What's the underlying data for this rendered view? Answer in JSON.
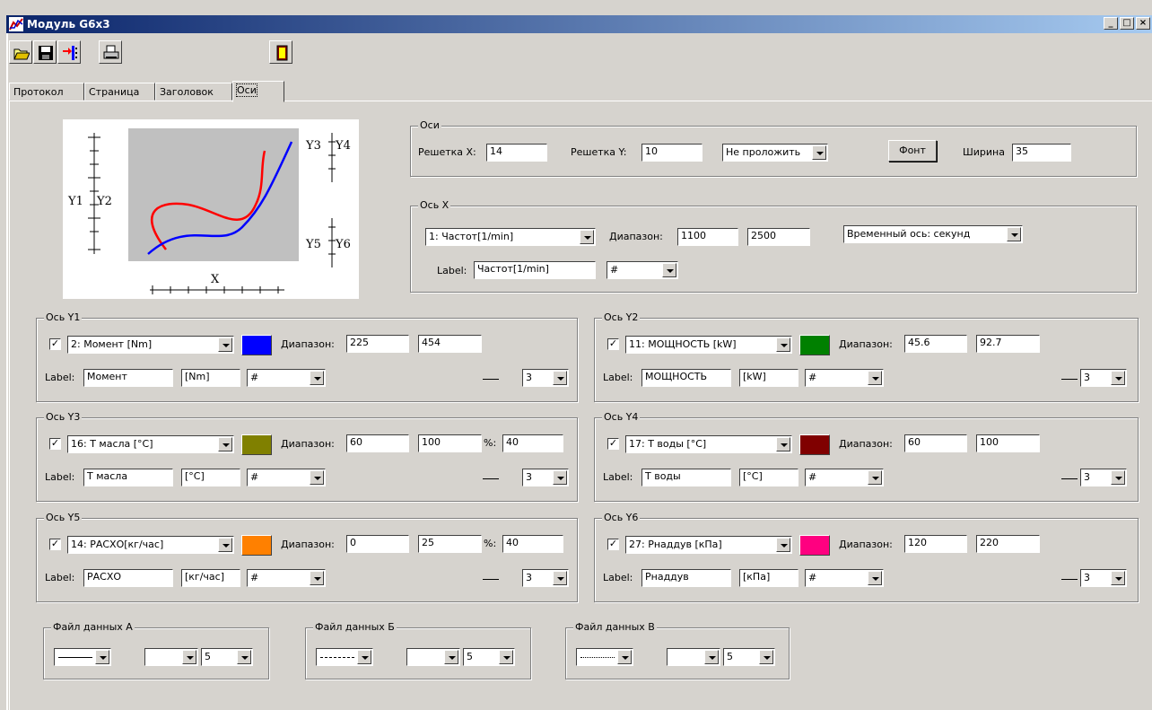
{
  "window": {
    "title": "Модуль G6x3",
    "controls": [
      "_",
      "□",
      "×"
    ]
  },
  "toolbar": {
    "icons": [
      "open-folder-icon",
      "save-icon",
      "import-icon",
      "print-icon",
      "exit-icon"
    ]
  },
  "tabs": [
    {
      "label": "Протокол"
    },
    {
      "label": "Страница"
    },
    {
      "label": "Заголовок"
    },
    {
      "label": "Оси",
      "active": true
    }
  ],
  "preview": {
    "y1": "Y1",
    "y2": "Y2",
    "y3": "Y3",
    "y4": "Y4",
    "y5": "Y5",
    "y6": "Y6",
    "x": "X",
    "colors": {
      "red": "#ff0000",
      "blue": "#0000ff",
      "plot_bg": "#c0c0c0"
    }
  },
  "axes": {
    "legend": "Оси",
    "grid_x_label": "Решетка X:",
    "grid_x": "14",
    "grid_y_label": "Решетка Y:",
    "grid_y": "10",
    "mode": "Не проложить",
    "font_button": "Фонт",
    "width_label": "Ширина",
    "width": "35"
  },
  "axis_x": {
    "legend": "Ось X",
    "channel": "1: Частот[1/min]",
    "range_label": "Диапазон:",
    "min": "1100",
    "max": "2500",
    "time_axis": "Временный ось: секунд",
    "label_caption": "Label:",
    "label": "Частот[1/min]",
    "fmt": "#"
  },
  "y_axes": [
    {
      "legend": "Ось Y1",
      "checked": true,
      "channel": "2: Момент  [Nm]",
      "color": "#0000ff",
      "range_label": "Диапазон:",
      "min": "225",
      "max": "454",
      "label_caption": "Label:",
      "label": "Момент",
      "unit": "[Nm]",
      "fmt": "#",
      "width": "3"
    },
    {
      "legend": "Ось Y2",
      "checked": true,
      "channel": "11: МОЩНОСТЬ [kW]",
      "color": "#008000",
      "range_label": "Диапазон:",
      "min": "45.6",
      "max": "92.7",
      "label_caption": "Label:",
      "label": "МОЩНОСТЬ",
      "unit": "[kW]",
      "fmt": "#",
      "width": "3"
    },
    {
      "legend": "Ось Y3",
      "checked": true,
      "channel": "16: Т масла  [°C]",
      "color": "#808000",
      "range_label": "Диапазон:",
      "min": "60",
      "max": "100",
      "pct_label": "%:",
      "pct": "40",
      "label_caption": "Label:",
      "label": "Т масла",
      "unit": "[°C]",
      "fmt": "#",
      "width": "3"
    },
    {
      "legend": "Ось Y4",
      "checked": true,
      "channel": "17: Т воды  [°C]",
      "color": "#800000",
      "range_label": "Диапазон:",
      "min": "60",
      "max": "100",
      "label_caption": "Label:",
      "label": "Т воды",
      "unit": "[°C]",
      "fmt": "#",
      "width": "3"
    },
    {
      "legend": "Ось Y5",
      "checked": true,
      "channel": "14: РАСХО[кг/час]",
      "color": "#ff8000",
      "range_label": "Диапазон:",
      "min": "0",
      "max": "25",
      "pct_label": "%:",
      "pct": "40",
      "label_caption": "Label:",
      "label": "РАСХО",
      "unit": "[кг/час]",
      "fmt": "#",
      "width": "3"
    },
    {
      "legend": "Ось Y6",
      "checked": true,
      "channel": "27: Рнаддув [кПа]",
      "color": "#ff0080",
      "range_label": "Диапазон:",
      "min": "120",
      "max": "220",
      "label_caption": "Label:",
      "label": "Рнаддув",
      "unit": "[кПа]",
      "fmt": "#",
      "width": "3"
    }
  ],
  "files": [
    {
      "legend": "Файл данных A",
      "line": "solid",
      "marker": "",
      "size": "5"
    },
    {
      "legend": "Файл данных Б",
      "line": "dashed",
      "marker": "",
      "size": "5"
    },
    {
      "legend": "Файл данных В",
      "line": "dotted",
      "marker": "",
      "size": "5"
    }
  ]
}
